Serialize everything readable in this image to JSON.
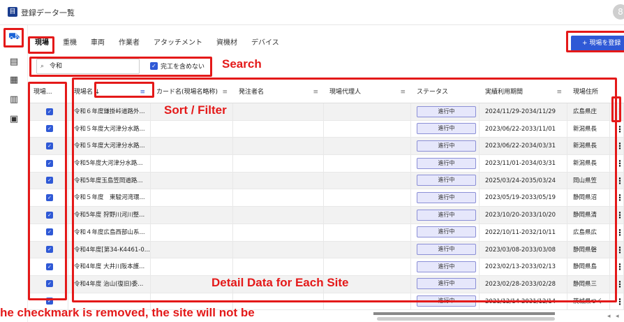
{
  "app": {
    "title": "登録データ一覧",
    "icon_label": "目",
    "avatar_glyph": "8"
  },
  "sidebar": {
    "items": [
      {
        "icon": "truck-icon",
        "glyph": "⛟"
      },
      {
        "icon": "document-icon",
        "glyph": "▤"
      },
      {
        "icon": "calendar-icon",
        "glyph": "▦"
      },
      {
        "icon": "map-icon",
        "glyph": "▥"
      },
      {
        "icon": "device-icon",
        "glyph": "▣"
      }
    ]
  },
  "tabs": [
    "現場",
    "重機",
    "車両",
    "作業者",
    "アタッチメント",
    "資機材",
    "デバイス"
  ],
  "add_button": "+ 現場を登録",
  "search": {
    "value": "令和",
    "glyph": "⌕",
    "exclude_label": "完工を含めない",
    "exclude_checked": true
  },
  "columns": {
    "check": "現場...",
    "name": "現場名",
    "card": "カード名(現場名略称)",
    "client": "発注者名",
    "agent": "現場代理人",
    "status": "ステータス",
    "period": "実績利用期間",
    "address": "現場住所"
  },
  "rows": [
    {
      "name": "令和６年度鎌掛峠道路外...",
      "status": "進行中",
      "period": "2024/11/29-2034/11/29",
      "address": "広島県庄"
    },
    {
      "name": "令和５年度大河津分水路...",
      "status": "進行中",
      "period": "2023/06/22-2033/11/01",
      "address": "新潟県長"
    },
    {
      "name": "令和５年度大河津分水路...",
      "status": "進行中",
      "period": "2023/06/22-2034/03/31",
      "address": "新潟県長"
    },
    {
      "name": "令和5年度大河津分水路...",
      "status": "進行中",
      "period": "2023/11/01-2034/03/31",
      "address": "新潟県長"
    },
    {
      "name": "令和5年度玉島笠岡道路...",
      "status": "進行中",
      "period": "2025/03/24-2035/03/24",
      "address": "岡山県笠"
    },
    {
      "name": "令和５年度　東駿河湾環...",
      "status": "進行中",
      "period": "2023/05/19-2033/05/19",
      "address": "静岡県沼"
    },
    {
      "name": "令和5年度 狩野川河川整...",
      "status": "進行中",
      "period": "2023/10/20-2033/10/20",
      "address": "静岡県清"
    },
    {
      "name": "令和４年度広島西部山系...",
      "status": "進行中",
      "period": "2022/10/11-2032/10/11",
      "address": "広島県広"
    },
    {
      "name": "令和4年度[第34-K4461-0...",
      "status": "進行中",
      "period": "2023/03/08-2033/03/08",
      "address": "静岡県磐"
    },
    {
      "name": "令和4年度 大井川阪本護...",
      "status": "進行中",
      "period": "2023/02/13-2033/02/13",
      "address": "静岡県島"
    },
    {
      "name": "令和4年度 治山(復旧)委...",
      "status": "進行中",
      "period": "2023/02/28-2033/02/28",
      "address": "静岡県三"
    },
    {
      "name": "",
      "status": "進行中",
      "period": "2021/12/14-2031/12/14",
      "address": "茨城県つく"
    }
  ],
  "callouts": {
    "search": "Search",
    "sort": "Sort / Filter",
    "detail": "Detail Data for Each Site",
    "note": "he checkmark is removed, the site will not be"
  },
  "accent_color": "#2f59d6",
  "callout_color": "#e41919"
}
